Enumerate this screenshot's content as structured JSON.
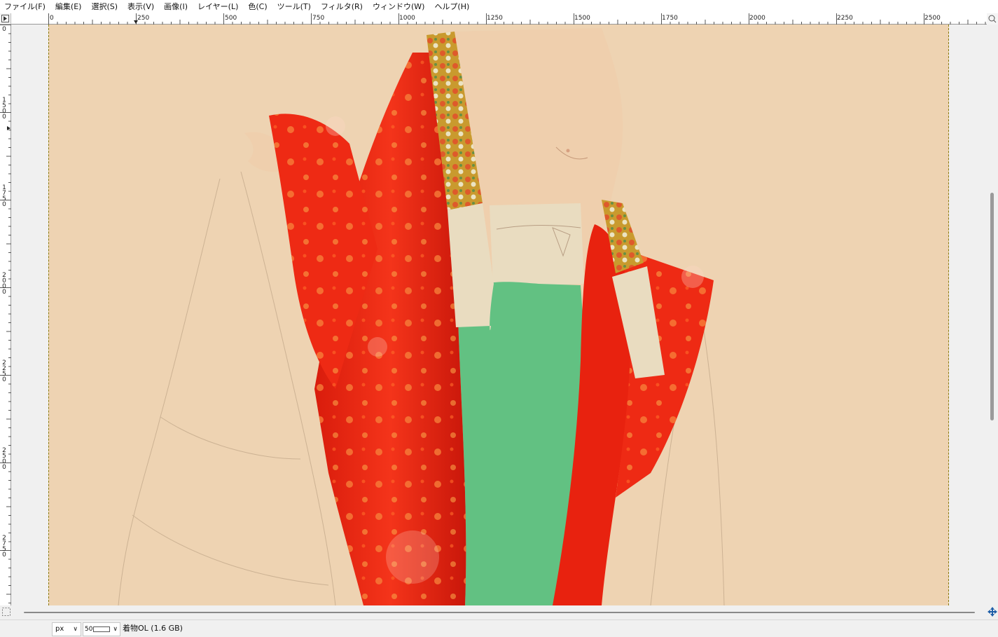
{
  "menu": [
    {
      "label": "ファイル(F)"
    },
    {
      "label": "編集(E)"
    },
    {
      "label": "選択(S)"
    },
    {
      "label": "表示(V)"
    },
    {
      "label": "画像(I)"
    },
    {
      "label": "レイヤー(L)"
    },
    {
      "label": "色(C)"
    },
    {
      "label": "ツール(T)"
    },
    {
      "label": "フィルタ(R)"
    },
    {
      "label": "ウィンドウ(W)"
    },
    {
      "label": "ヘルプ(H)"
    }
  ],
  "hruler": {
    "labels": [
      "0",
      "250",
      "500",
      "750",
      "1000",
      "1250",
      "1500",
      "1750",
      "2000",
      "2250",
      "2500"
    ]
  },
  "vruler": {
    "labels": [
      "0",
      "1500",
      "1750",
      "2000",
      "2250",
      "2500",
      "2750"
    ]
  },
  "statusbar": {
    "unit": "px",
    "zoom": "50",
    "info": "着物OL (1.6 GB)"
  },
  "colors": {
    "canvas_background": "#eed3b2",
    "kimono_red": "#e8220f",
    "skirt_green": "#62c182",
    "collar_gold": "#c99a2e",
    "skin": "#efcfad",
    "underwear_cream": "#e9dcc0"
  }
}
